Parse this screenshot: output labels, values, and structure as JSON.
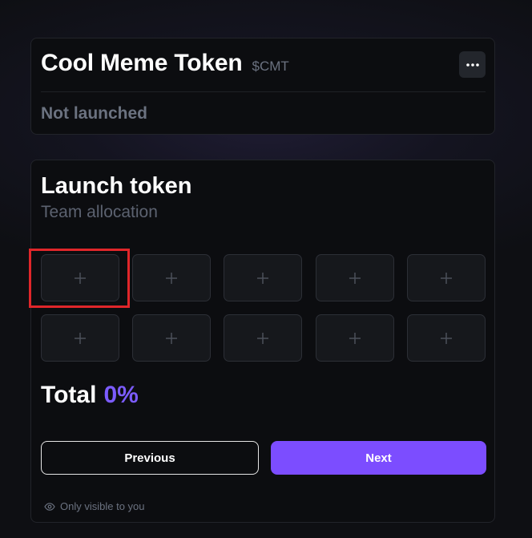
{
  "token": {
    "name": "Cool Meme Token",
    "symbol": "$CMT",
    "status": "Not launched",
    "menu_icon": "more-horizontal-icon"
  },
  "launch": {
    "title": "Launch token",
    "subtitle": "Team allocation",
    "slot_icon": "plus-icon",
    "slot_count": 10,
    "total_label": "Total",
    "total_value": "0%",
    "previous_label": "Previous",
    "next_label": "Next",
    "visibility_note": "Only visible to you",
    "visibility_icon": "eye-icon"
  },
  "colors": {
    "accent": "#7c4dff",
    "total_value": "#7c5cff",
    "highlight": "#e0262a"
  }
}
